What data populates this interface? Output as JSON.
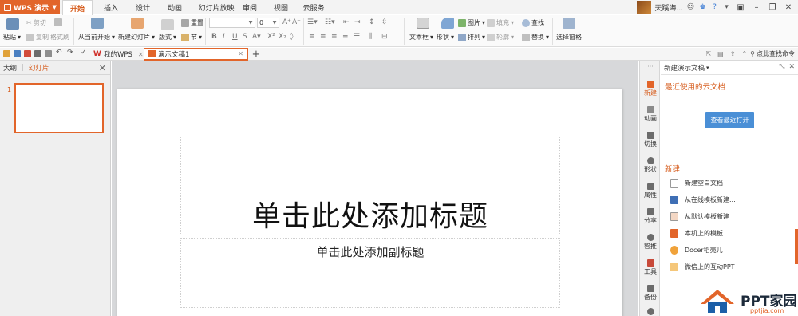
{
  "menubar": {
    "app_button": "WPS 演示",
    "tabs": [
      "开始",
      "插入",
      "设计",
      "动画",
      "幻灯片放映",
      "审阅",
      "视图",
      "云服务"
    ],
    "user_name": "天蹊海..."
  },
  "ribbon": {
    "paste": "粘贴",
    "cut": "剪切",
    "copy": "复制",
    "format_painter": "格式刷",
    "from_current": "从当前开始",
    "new_slide": "新建幻灯片",
    "layout": "版式",
    "reset": "重置",
    "section": "节",
    "font_size": "0",
    "text_box": "文本框",
    "shape": "形状",
    "picture": "图片",
    "fill": "填充",
    "arrange": "排列",
    "outline": "轮廓",
    "find": "查找",
    "replace": "替换",
    "select_pane": "选择窗格"
  },
  "doc_tabs": [
    {
      "label": "我的WPS"
    },
    {
      "label": "演示文稿1"
    }
  ],
  "find_command": "点此查找命令",
  "left_pane": {
    "tab_outline": "大纲",
    "tab_slides": "幻灯片",
    "slide_number": "1"
  },
  "slide": {
    "title_placeholder": "单击此处添加标题",
    "subtitle_placeholder": "单击此处添加副标题"
  },
  "vertical_tools": [
    {
      "label": "新建",
      "icon": "new-icon"
    },
    {
      "label": "动画",
      "icon": "animation-icon"
    },
    {
      "label": "切换",
      "icon": "transition-icon"
    },
    {
      "label": "形状",
      "icon": "shape-icon"
    },
    {
      "label": "属性",
      "icon": "properties-icon"
    },
    {
      "label": "分享",
      "icon": "share-icon"
    },
    {
      "label": "智推",
      "icon": "smart-icon"
    },
    {
      "label": "工具",
      "icon": "tools-icon"
    },
    {
      "label": "备份",
      "icon": "backup-icon"
    }
  ],
  "task_pane": {
    "title": "新建演示文稿",
    "recent_heading": "最近使用的云文档",
    "view_recent_button": "查看最近打开",
    "new_heading": "新建",
    "items": [
      {
        "label": "新建空白文档"
      },
      {
        "label": "从在线模板新建..."
      },
      {
        "label": "从默认模板新建"
      },
      {
        "label": "本机上的模板..."
      },
      {
        "label": "Docer稻壳儿"
      },
      {
        "label": "微信上的互动PPT"
      }
    ]
  },
  "watermark": {
    "brand": "PPT家园",
    "url": "pptjia.com"
  },
  "colors": {
    "accent": "#e2652a",
    "button_blue": "#4a8fd6"
  }
}
